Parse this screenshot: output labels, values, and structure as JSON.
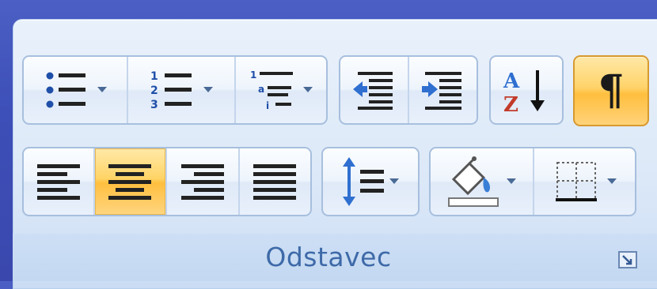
{
  "ribbon_group": {
    "label": "Odstavec",
    "controls": {
      "bullets": "bullets-icon",
      "numbering": "numbering-icon",
      "multilevel_list": "multilevel-list-icon",
      "decrease_indent": "decrease-indent-icon",
      "increase_indent": "increase-indent-icon",
      "sort": "sort-az-icon",
      "show_marks": {
        "glyph": "¶",
        "state": "active"
      },
      "align_left": "align-left-icon",
      "align_center": {
        "icon": "align-center-icon",
        "state": "active"
      },
      "align_right": "align-right-icon",
      "justify": "justify-icon",
      "line_spacing": "line-spacing-icon",
      "shading": "paint-bucket-icon",
      "borders": "borders-icon",
      "dialog_launcher": "dialog-launcher-icon"
    }
  },
  "colors": {
    "active_highlight": "#ffc94d",
    "label_text": "#3e6aa8",
    "icon_blue": "#2f6fd0",
    "sort_red": "#c23b2b"
  }
}
